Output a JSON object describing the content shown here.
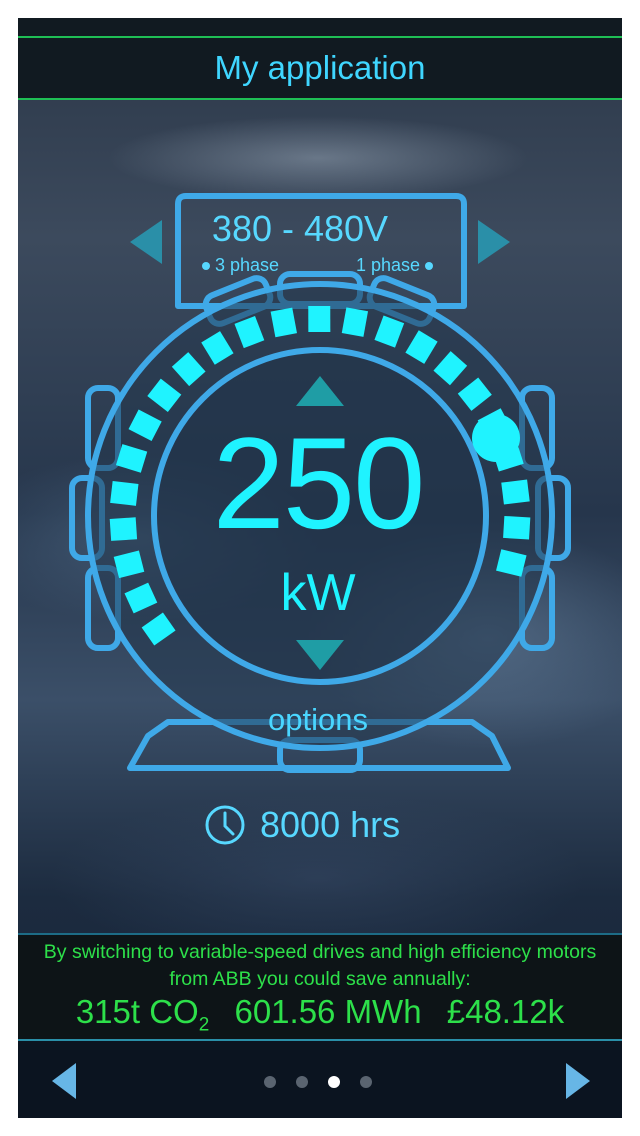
{
  "header": {
    "title": "My application"
  },
  "voltage": {
    "range": "380 - 480V",
    "phase_left": "3 phase",
    "phase_right": "1 phase"
  },
  "power": {
    "value": "250",
    "unit": "kW",
    "dial_level": 0.9
  },
  "options_label": "options",
  "hours": {
    "value": "8000 hrs"
  },
  "savings": {
    "text": "By switching to variable-speed drives and high efficiency motors from ABB you could save annually:",
    "co2_value": "315t CO",
    "co2_sub": "2",
    "energy": "601.56 MWh",
    "money": "£48.12k"
  },
  "pagination": {
    "pages": 4,
    "current": 3
  },
  "colors": {
    "accent": "#1ff3ff",
    "outline": "#3fa9e8",
    "savings_text": "#2de04a",
    "header_line": "#1fbf55"
  },
  "icons": {
    "prev": "triangle-left-icon",
    "next": "triangle-right-icon",
    "clock": "clock-icon"
  }
}
